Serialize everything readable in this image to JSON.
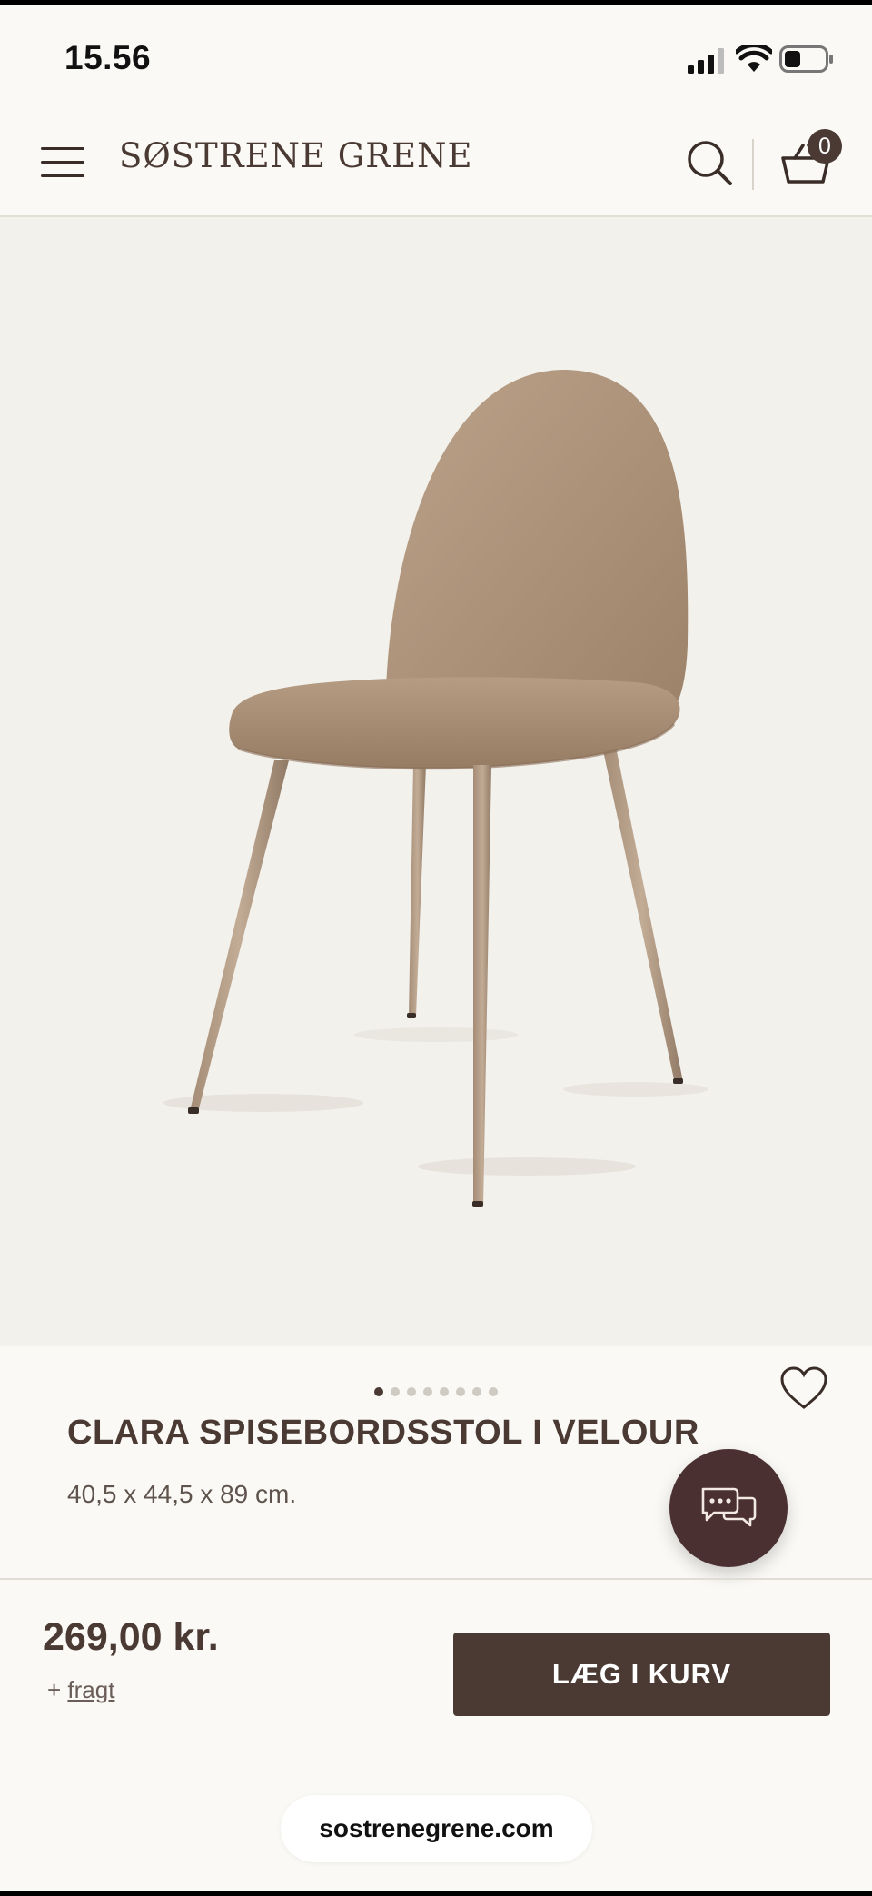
{
  "status_bar": {
    "time": "15.56"
  },
  "header": {
    "logo_text": "SØSTRENE GRENE",
    "basket_count": "0",
    "icons": [
      "menu-icon",
      "search-icon",
      "basket-icon"
    ]
  },
  "product": {
    "image_alt_icon": "chair-image",
    "carousel_total": 8,
    "carousel_active": 1,
    "title": "CLARA SPISEBORDSSTOL I VELOUR",
    "dimensions": "40,5 x 44,5 x 89 cm.",
    "price": "269,00 kr.",
    "shipping_prefix": "+ ",
    "shipping_link": "fragt",
    "add_to_cart_label": "LÆG I KURV"
  },
  "browser": {
    "url": "sostrenegrene.com"
  },
  "colors": {
    "brand_brown": "#4b3a33",
    "background": "#faf9f5",
    "image_background": "#f3f1ec",
    "chair_velour": "#b59a80"
  }
}
